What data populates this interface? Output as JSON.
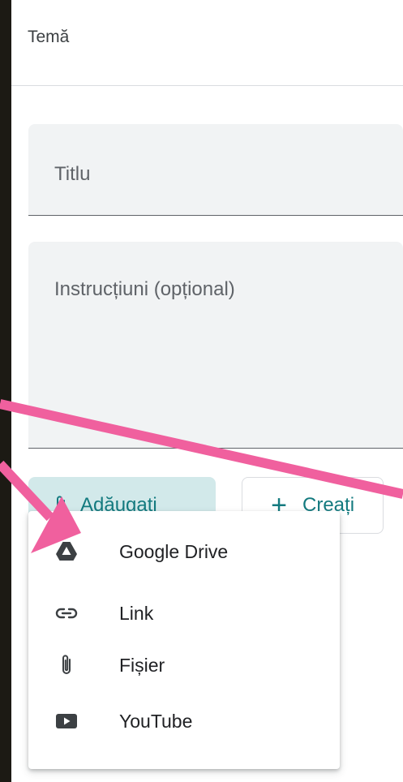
{
  "header": {
    "title": "Temă"
  },
  "form": {
    "title_placeholder": "Titlu",
    "instructions_placeholder": "Instrucțiuni (opțional)"
  },
  "buttons": {
    "add_label": "Adăugați",
    "create_label": "Creați"
  },
  "menu": {
    "items": [
      {
        "label": "Google Drive",
        "icon": "google-drive-icon"
      },
      {
        "label": "Link",
        "icon": "link-icon"
      },
      {
        "label": "Fișier",
        "icon": "paperclip-icon"
      },
      {
        "label": "YouTube",
        "icon": "youtube-icon"
      }
    ]
  },
  "colors": {
    "accent": "#137a7f",
    "accent_bg": "#d2e9ea",
    "annotation_arrow": "#f0609e",
    "field_bg": "#f1f3f4",
    "frame": "#1c1a14"
  }
}
